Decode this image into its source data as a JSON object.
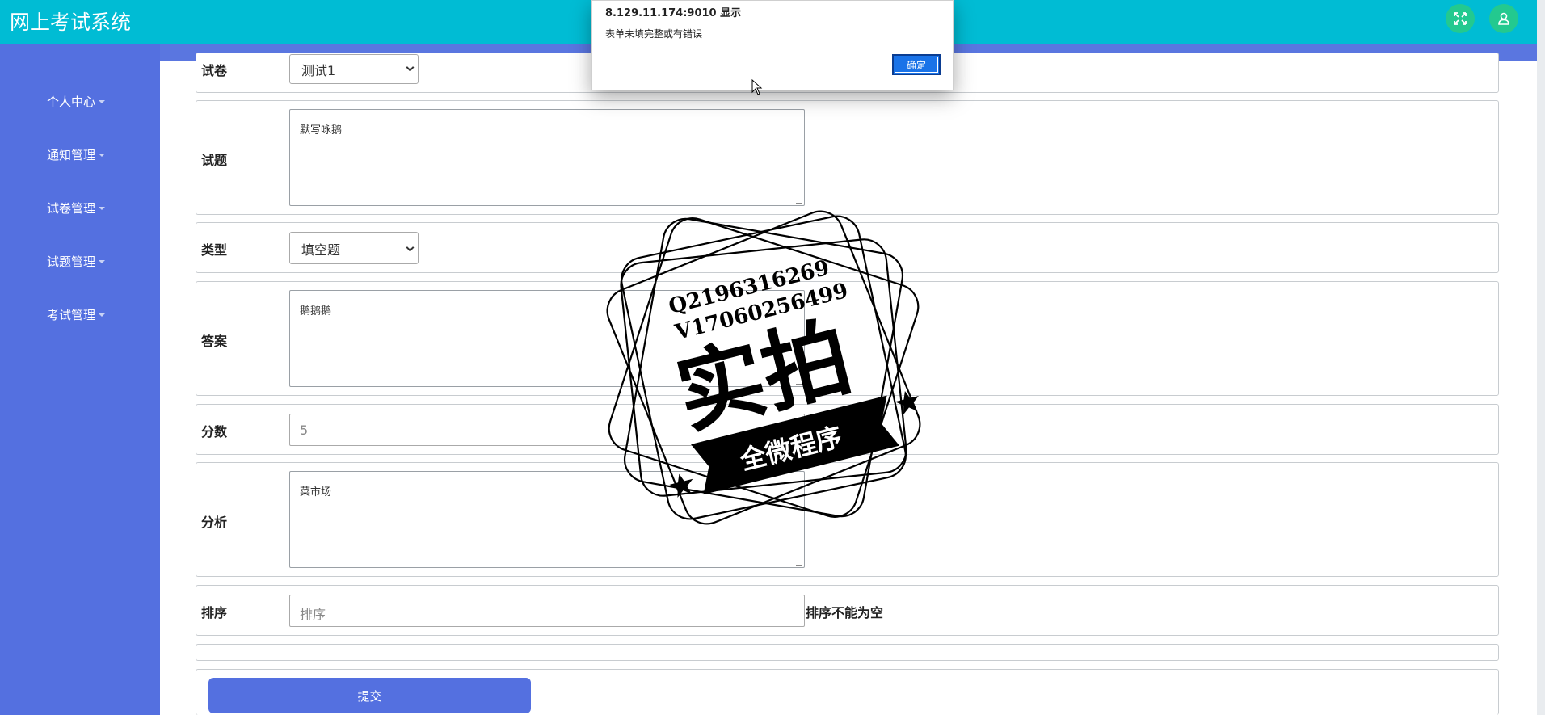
{
  "header": {
    "title": "网上考试系统",
    "fullscreen_icon": "expand-icon",
    "user_icon": "user-icon",
    "bg_color": "#00bcd4",
    "btn_color": "#23c98f"
  },
  "sidebar": {
    "bg_color": "#5470e0",
    "items": [
      {
        "label": "个人中心"
      },
      {
        "label": "通知管理"
      },
      {
        "label": "试卷管理"
      },
      {
        "label": "试题管理"
      },
      {
        "label": "考试管理"
      }
    ]
  },
  "form": {
    "paper": {
      "label": "试卷",
      "value": "测试1"
    },
    "question": {
      "label": "试题",
      "value": "默写咏鹅"
    },
    "type": {
      "label": "类型",
      "value": "填空题"
    },
    "answer": {
      "label": "答案",
      "value": "鹅鹅鹅"
    },
    "score": {
      "label": "分数",
      "value": "5"
    },
    "analysis": {
      "label": "分析",
      "value": "菜市场"
    },
    "order": {
      "label": "排序",
      "placeholder": "排序",
      "error": "排序不能为空"
    },
    "submit_label": "提交"
  },
  "alert": {
    "title": "8.129.11.174:9010 显示",
    "message": "表单未填完整或有错误",
    "ok_label": "确定"
  },
  "watermark": {
    "line1": "Q2196316269",
    "line2": "V17060256499",
    "main": "实拍",
    "banner": "全微程序"
  }
}
